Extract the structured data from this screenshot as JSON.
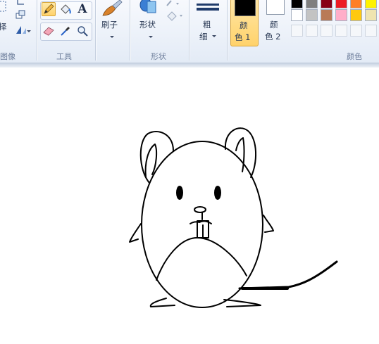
{
  "groups": {
    "image_label": "图像",
    "tools_label": "工具",
    "shapes_label": "形状",
    "colors_label": "颜色"
  },
  "image": {
    "select_partial": "择"
  },
  "brushes": {
    "label": "刷子"
  },
  "shapes": {
    "label": "形状"
  },
  "size": {
    "line1": "粗",
    "line2": "细"
  },
  "color1": {
    "line1": "颜",
    "line2": "色 1",
    "color": "#000000"
  },
  "color2": {
    "line1": "颜",
    "line2": "色 2",
    "color": "#ffffff"
  },
  "text_tool": {
    "glyph": "A"
  },
  "palette": {
    "row1": [
      "#000000",
      "#7f7f7f",
      "#880015",
      "#ed1c24",
      "#ff7f27",
      "#fff200"
    ],
    "row2": [
      "#ffffff",
      "#c3c3c3",
      "#b97a57",
      "#ffaec9",
      "#ffc90e",
      "#efe4b0"
    ],
    "row3": [
      "",
      "",
      "",
      "",
      "",
      ""
    ]
  },
  "accent": "#ffd26b"
}
